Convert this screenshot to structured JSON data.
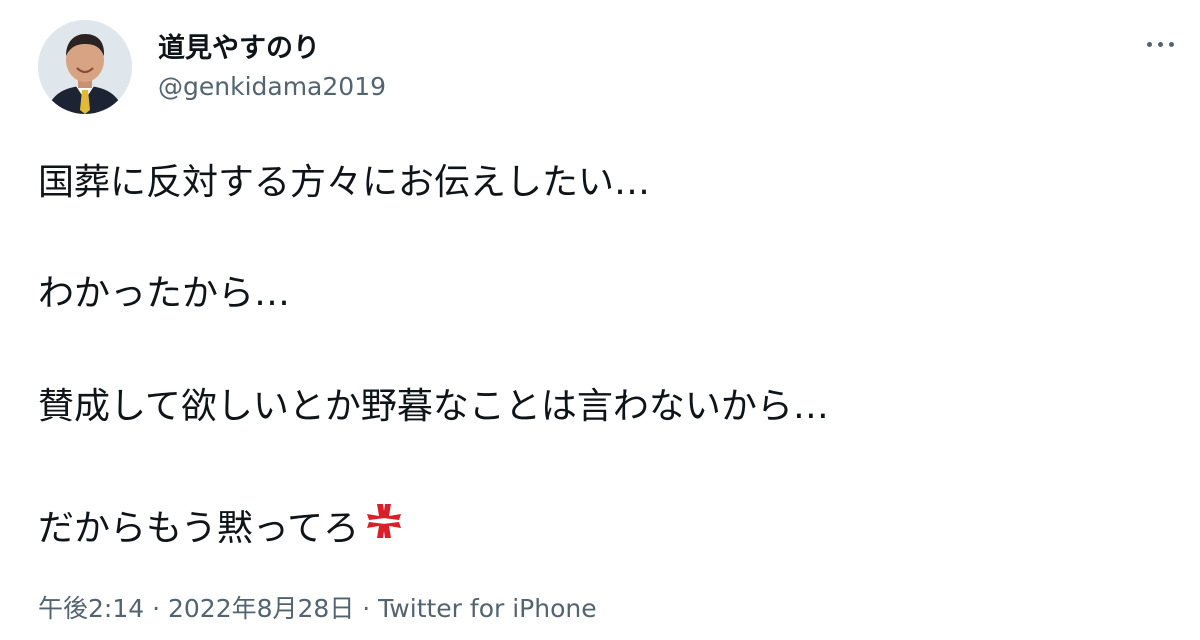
{
  "user": {
    "display_name": "道見やすのり",
    "handle": "@genkidama2019",
    "avatar": "profile-photo"
  },
  "tweet": {
    "lines": [
      "国葬に反対する方々にお伝えしたい…",
      "わかったから…",
      "賛成して欲しいとか野暮なことは言わないから…",
      "だからもう黙ってろ"
    ],
    "emoji": "anger-symbol-icon"
  },
  "meta": {
    "time": "午後2:14",
    "separator": " · ",
    "date": "2022年8月28日",
    "source": "Twitter for iPhone"
  },
  "icons": {
    "more": "more-options-icon"
  },
  "colors": {
    "text": "#0f1419",
    "secondary": "#536471",
    "anger": "#d9202a"
  }
}
